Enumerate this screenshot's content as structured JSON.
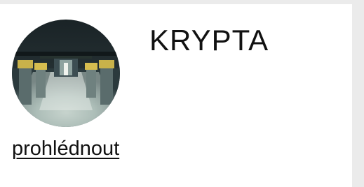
{
  "card": {
    "title": "KRYPTA",
    "link_label": "prohlédnout",
    "image_subject": "crypt-interior-photo"
  },
  "colors": {
    "page_background": "#ebebeb",
    "card_background": "#ffffff",
    "text": "#111111"
  }
}
